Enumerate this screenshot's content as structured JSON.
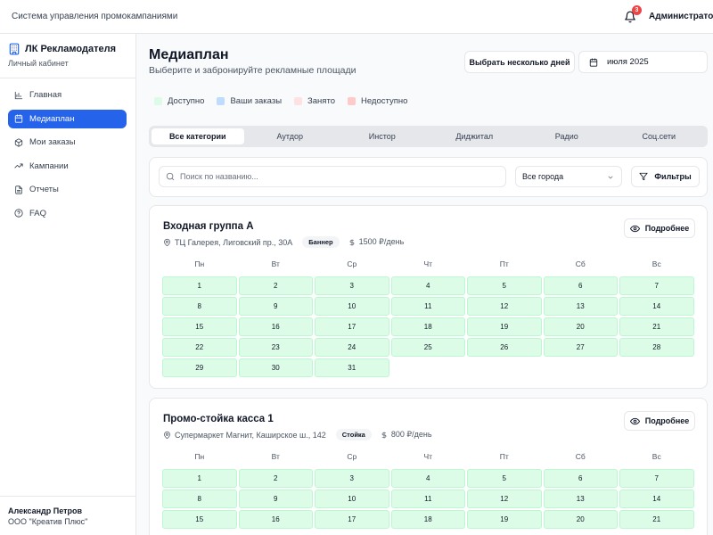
{
  "topbar": {
    "app_title": "Система управления промокампаниями",
    "notification_count": "3",
    "user_role": "Администратор"
  },
  "sidebar": {
    "brand_name": "ЛК Рекламодателя",
    "brand_sub": "Личный кабинет",
    "items": [
      {
        "label": "Главная",
        "icon": "home-icon"
      },
      {
        "label": "Медиаплан",
        "icon": "calendar-icon",
        "active": true
      },
      {
        "label": "Мои заказы",
        "icon": "package-icon"
      },
      {
        "label": "Кампании",
        "icon": "trending-up-icon"
      },
      {
        "label": "Отчеты",
        "icon": "file-text-icon"
      },
      {
        "label": "FAQ",
        "icon": "help-circle-icon"
      }
    ],
    "user_name": "Александр Петров",
    "user_org": "ООО \"Креатив Плюс\""
  },
  "main": {
    "title": "Медиаплан",
    "subtitle": "Выберите и забронируйте рекламные площади",
    "multi_days_button": "Выбрать несколько дней",
    "date_value": "июля 2025",
    "legend": [
      {
        "label": "Доступно",
        "color": "#dcfce7"
      },
      {
        "label": "Ваши заказы",
        "color": "#bfdbfe"
      },
      {
        "label": "Занято",
        "color": "#fee2e2"
      },
      {
        "label": "Недоступно",
        "color": "#fecaca"
      }
    ],
    "tabs": [
      "Все категории",
      "Аутдор",
      "Инстор",
      "Диджитал",
      "Радио",
      "Соц.сети"
    ],
    "active_tab": "Все категории",
    "search_placeholder": "Поиск по названию...",
    "city_select": "Все города",
    "filters_button": "Фильтры",
    "weekdays": [
      "Пн",
      "Вт",
      "Ср",
      "Чт",
      "Пт",
      "Сб",
      "Вс"
    ],
    "venues": [
      {
        "name": "Входная группа А",
        "address": "ТЦ Галерея, Лиговский пр., 30А",
        "type": "Баннер",
        "price": "1500 ₽/день",
        "details_button": "Подробнее",
        "days": [
          "1",
          "2",
          "3",
          "4",
          "5",
          "6",
          "7",
          "8",
          "9",
          "10",
          "11",
          "12",
          "13",
          "14",
          "15",
          "16",
          "17",
          "18",
          "19",
          "20",
          "21",
          "22",
          "23",
          "24",
          "25",
          "26",
          "27",
          "28",
          "29",
          "30",
          "31"
        ]
      },
      {
        "name": "Промо-стойка касса 1",
        "address": "Супермаркет Магнит, Каширское ш., 142",
        "type": "Стойка",
        "price": "800 ₽/день",
        "details_button": "Подробнее",
        "days": [
          "1",
          "2",
          "3",
          "4",
          "5",
          "6",
          "7",
          "8",
          "9",
          "10",
          "11",
          "12",
          "13",
          "14",
          "15",
          "16",
          "17",
          "18",
          "19",
          "20",
          "21"
        ]
      }
    ]
  }
}
